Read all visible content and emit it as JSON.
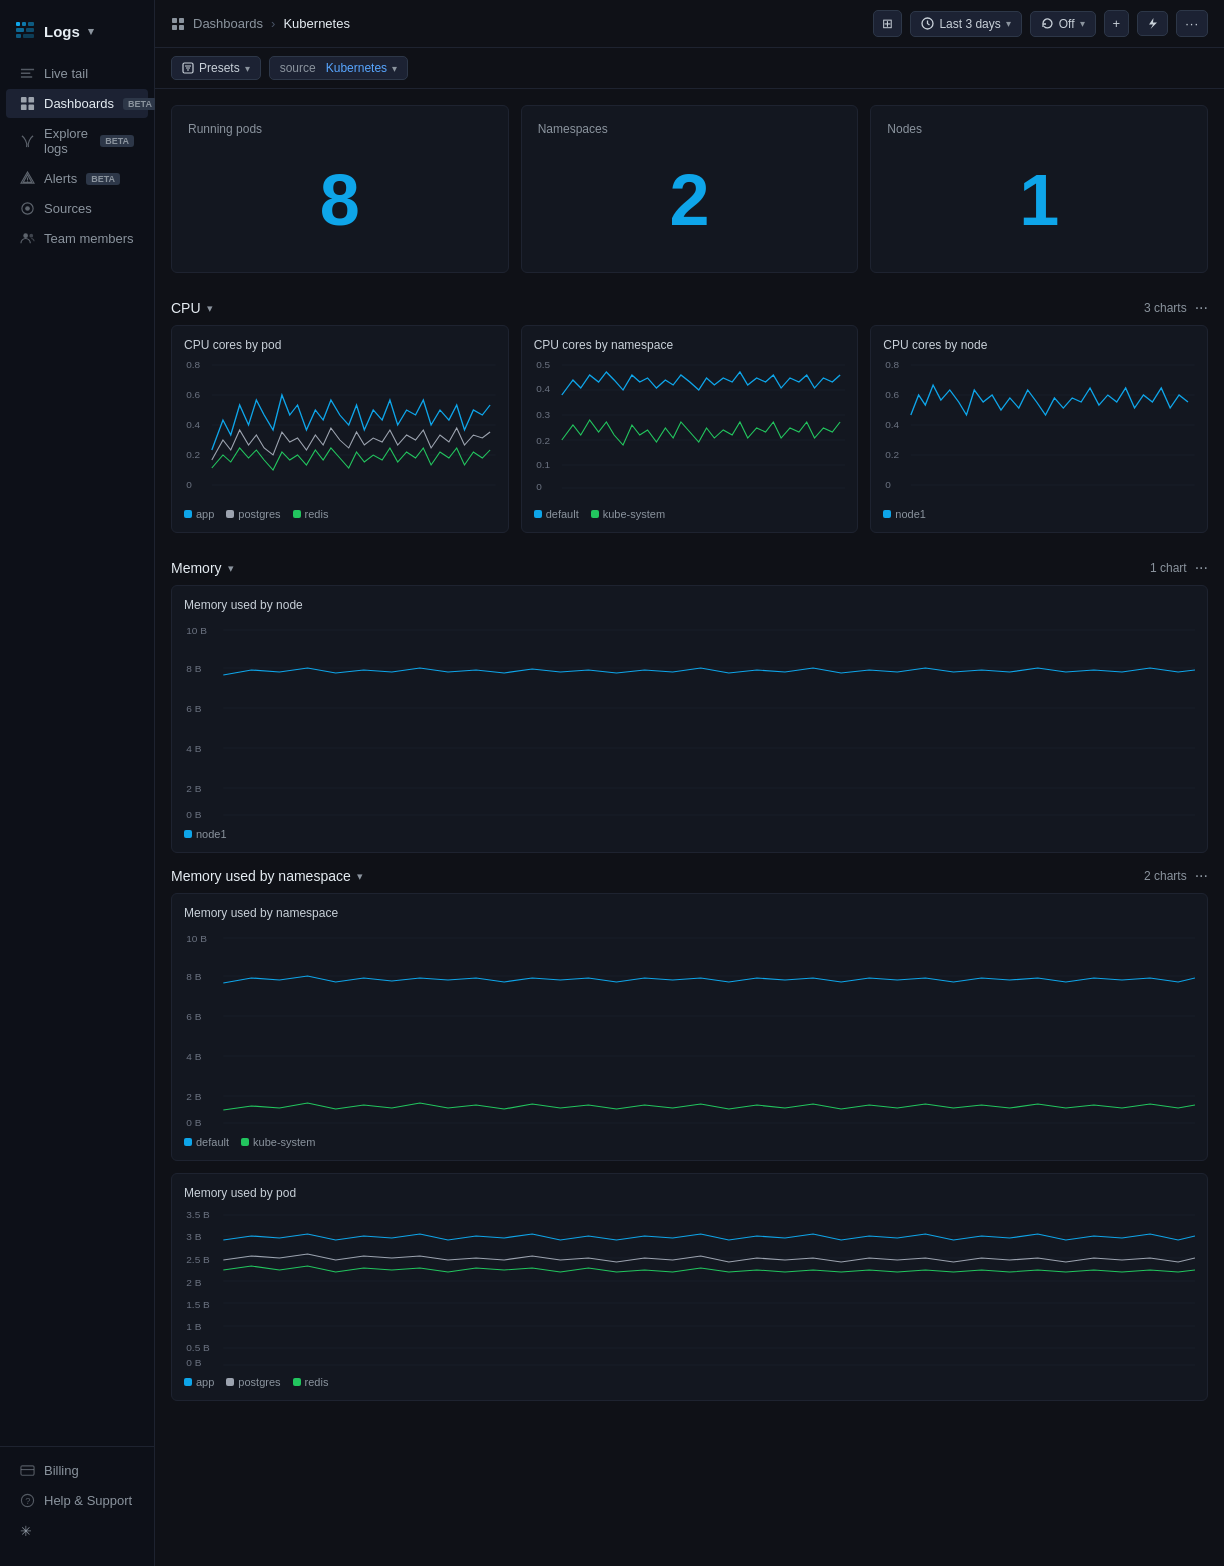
{
  "app": {
    "name": "Logs",
    "chevron": "▾"
  },
  "sidebar": {
    "items": [
      {
        "id": "live-tail",
        "label": "Live tail",
        "icon": "stream"
      },
      {
        "id": "dashboards",
        "label": "Dashboards",
        "badge": "BETA",
        "active": true
      },
      {
        "id": "explore-logs",
        "label": "Explore logs",
        "badge": "BETA"
      },
      {
        "id": "alerts",
        "label": "Alerts",
        "badge": "BETA"
      },
      {
        "id": "sources",
        "label": "Sources"
      },
      {
        "id": "team-members",
        "label": "Team members"
      }
    ],
    "bottom": [
      {
        "id": "billing",
        "label": "Billing"
      },
      {
        "id": "help-support",
        "label": "Help & Support"
      }
    ]
  },
  "topbar": {
    "breadcrumb": "Dashboards",
    "separator": "›",
    "page_title": "Kubernetes",
    "buttons": {
      "view": "⊞",
      "time_range": "Last 3 days",
      "refresh": "Off",
      "add": "+",
      "lightning": "⚡",
      "more": "···"
    }
  },
  "filters": {
    "presets_label": "Presets",
    "source_label": "source",
    "source_value": "Kubernetes"
  },
  "stats": [
    {
      "title": "Running pods",
      "value": "8"
    },
    {
      "title": "Namespaces",
      "value": "2"
    },
    {
      "title": "Nodes",
      "value": "1"
    }
  ],
  "cpu_section": {
    "title": "CPU",
    "count": "3 charts",
    "charts": [
      {
        "title": "CPU cores by pod",
        "ymax": "0.8",
        "yvals": [
          "0.8",
          "0.6",
          "0.4",
          "0.2",
          "0"
        ],
        "legend": [
          {
            "color": "#0ea5e9",
            "label": "app"
          },
          {
            "color": "#6b7280",
            "label": "postgres"
          },
          {
            "color": "#22c55e",
            "label": "redis"
          }
        ]
      },
      {
        "title": "CPU cores by namespace",
        "ymax": "0.5",
        "yvals": [
          "0.5",
          "0.4",
          "0.3",
          "0.2",
          "0.1",
          "0"
        ],
        "legend": [
          {
            "color": "#0ea5e9",
            "label": "default"
          },
          {
            "color": "#22c55e",
            "label": "kube-system"
          }
        ]
      },
      {
        "title": "CPU cores by node",
        "ymax": "0.8",
        "yvals": [
          "0.8",
          "0.6",
          "0.4",
          "0.2",
          "0"
        ],
        "legend": [
          {
            "color": "#0ea5e9",
            "label": "node1"
          }
        ]
      }
    ]
  },
  "memory_node_section": {
    "title": "Memory",
    "count": "1 chart",
    "chart": {
      "title": "Memory used by node",
      "yvals": [
        "10 B",
        "8 B",
        "6 B",
        "4 B",
        "2 B",
        "0 B"
      ],
      "legend": [
        {
          "color": "#0ea5e9",
          "label": "node1"
        }
      ]
    }
  },
  "memory_namespace_section": {
    "title": "Memory used by namespace",
    "count": "2 charts",
    "charts": [
      {
        "title": "Memory used by namespace",
        "yvals": [
          "10 B",
          "8 B",
          "6 B",
          "4 B",
          "2 B",
          "0 B"
        ],
        "legend": [
          {
            "color": "#0ea5e9",
            "label": "default"
          },
          {
            "color": "#22c55e",
            "label": "kube-system"
          }
        ]
      },
      {
        "title": "Memory used by pod",
        "yvals": [
          "3.5 B",
          "3 B",
          "2.5 B",
          "2 B",
          "1.5 B",
          "1 B",
          "0.5 B",
          "0 B"
        ],
        "legend": [
          {
            "color": "#0ea5e9",
            "label": "app"
          },
          {
            "color": "#6b7280",
            "label": "postgres"
          },
          {
            "color": "#22c55e",
            "label": "redis"
          }
        ]
      }
    ]
  }
}
